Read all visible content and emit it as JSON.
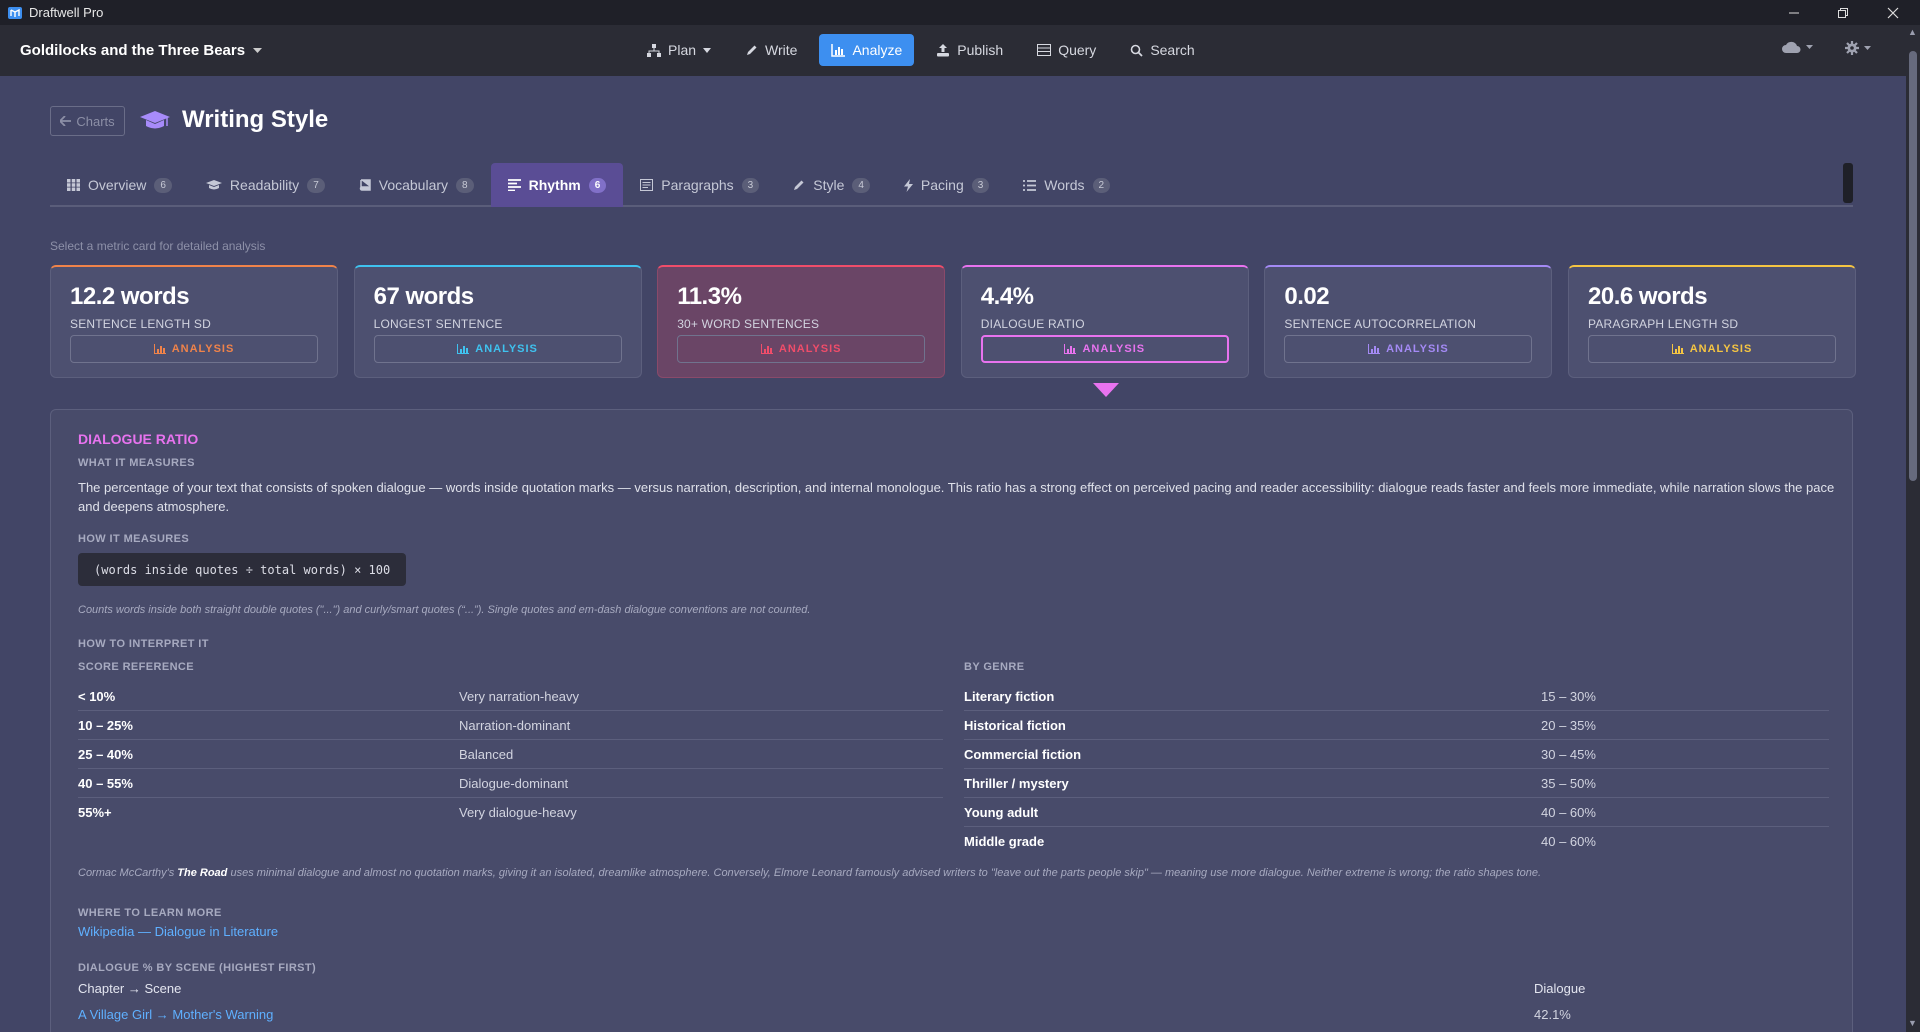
{
  "window": {
    "title": "Draftwell Pro"
  },
  "navbar": {
    "doc_title": "Goldilocks and the Three Bears",
    "items": [
      {
        "label": "Plan",
        "icon": "sitemap-icon",
        "dropdown": true
      },
      {
        "label": "Write",
        "icon": "pencil-icon"
      },
      {
        "label": "Analyze",
        "icon": "bar-chart-icon",
        "active": true
      },
      {
        "label": "Publish",
        "icon": "upload-icon"
      },
      {
        "label": "Query",
        "icon": "table-icon"
      },
      {
        "label": "Search",
        "icon": "search-icon"
      }
    ]
  },
  "header": {
    "back_label": "Charts",
    "title": "Writing Style"
  },
  "tabs": [
    {
      "label": "Overview",
      "count": "6"
    },
    {
      "label": "Readability",
      "count": "7"
    },
    {
      "label": "Vocabulary",
      "count": "8"
    },
    {
      "label": "Rhythm",
      "count": "6"
    },
    {
      "label": "Paragraphs",
      "count": "3"
    },
    {
      "label": "Style",
      "count": "4"
    },
    {
      "label": "Pacing",
      "count": "3"
    },
    {
      "label": "Words",
      "count": "2"
    }
  ],
  "hint": "Select a metric card for detailed analysis",
  "cards": [
    {
      "value": "12.2 words",
      "label": "SENTENCE LENGTH SD",
      "button": "ANALYSIS",
      "accent": "#f0834a"
    },
    {
      "value": "67 words",
      "label": "LONGEST SENTENCE",
      "button": "ANALYSIS",
      "accent": "#3fc2ef"
    },
    {
      "value": "11.3%",
      "label": "30+ WORD SENTENCES",
      "button": "ANALYSIS",
      "accent": "#f04d6a"
    },
    {
      "value": "4.4%",
      "label": "DIALOGUE RATIO",
      "button": "ANALYSIS",
      "accent": "#e873ef"
    },
    {
      "value": "0.02",
      "label": "SENTENCE AUTOCORRELATION",
      "button": "ANALYSIS",
      "accent": "#a48af5"
    },
    {
      "value": "20.6 words",
      "label": "PARAGRAPH LENGTH SD",
      "button": "ANALYSIS",
      "accent": "#f5c542"
    }
  ],
  "detail": {
    "title": "DIALOGUE RATIO",
    "what_heading": "WHAT IT MEASURES",
    "what_text": "The percentage of your text that consists of spoken dialogue — words inside quotation marks — versus narration, description, and internal monologue. This ratio has a strong effect on perceived pacing and reader accessibility: dialogue reads faster and feels more immediate, while narration slows the pace and deepens atmosphere.",
    "how_heading": "HOW IT MEASURES",
    "formula": "(words inside quotes ÷ total words) × 100",
    "note": "Counts words inside both straight double quotes (\"...\") and curly/smart quotes (“...”). Single quotes and em-dash dialogue conventions are not counted.",
    "interpret_heading": "HOW TO INTERPRET IT",
    "score_heading": "SCORE REFERENCE",
    "score_rows": [
      {
        "range": "< 10%",
        "desc": "Very narration-heavy"
      },
      {
        "range": "10 – 25%",
        "desc": "Narration-dominant"
      },
      {
        "range": "25 – 40%",
        "desc": "Balanced"
      },
      {
        "range": "40 – 55%",
        "desc": "Dialogue-dominant"
      },
      {
        "range": "55%+",
        "desc": "Very dialogue-heavy"
      }
    ],
    "genre_heading": "BY GENRE",
    "genre_rows": [
      {
        "genre": "Literary fiction",
        "range": "15 – 30%"
      },
      {
        "genre": "Historical fiction",
        "range": "20 – 35%"
      },
      {
        "genre": "Commercial fiction",
        "range": "30 – 45%"
      },
      {
        "genre": "Thriller / mystery",
        "range": "35 – 50%"
      },
      {
        "genre": "Young adult",
        "range": "40 – 60%"
      },
      {
        "genre": "Middle grade",
        "range": "40 – 60%"
      }
    ],
    "quote_pre": "Cormac McCarthy's ",
    "quote_book": "The Road",
    "quote_post": " uses minimal dialogue and almost no quotation marks, giving it an isolated, dreamlike atmosphere. Conversely, Elmore Leonard famously advised writers to \"leave out the parts people skip\" — meaning use more dialogue. Neither extreme is wrong; the ratio shapes tone.",
    "learn_heading": "WHERE TO LEARN MORE",
    "learn_link": "Wikipedia — Dialogue in Literature",
    "scene_heading": "DIALOGUE % BY SCENE (HIGHEST FIRST)",
    "scene_col1": "Chapter → Scene",
    "scene_col2": "Dialogue",
    "scene_rows": [
      {
        "scene": "A Village Girl → Mother's Warning",
        "value": "42.1%"
      }
    ]
  }
}
